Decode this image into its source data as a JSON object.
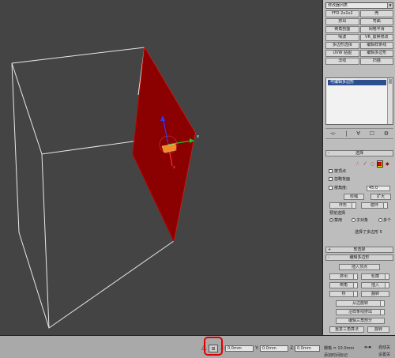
{
  "modifier_panel": {
    "dropdown_value": "修改器列表",
    "modifiers": [
      "FFD 2x2x2",
      "壳",
      "挤出",
      "弯曲",
      "倒角剖面",
      "网格平滑",
      "噪波",
      "VR_置换修改",
      "多边形选择",
      "编辑样条线",
      "UVW 贴图",
      "编辑多边形",
      "法线",
      "扫描"
    ],
    "stack_item": "可编辑多边形",
    "stack_tools": [
      "-ι-",
      "|",
      "∀",
      "☐",
      "⚙"
    ]
  },
  "selection": {
    "title": "选择",
    "by_vertex": "按顶点",
    "ignore_backfacing": "忽略背面",
    "by_angle": "按角度:",
    "angle_value": "45.0",
    "shrink": "收缩",
    "grow": "扩大",
    "ring": "环形",
    "loop": "循环",
    "preview_title": "预览选择",
    "preview_disable": "禁用",
    "preview_subobj": "子对象",
    "preview_multi": "多个",
    "status": "选择了多边形 5"
  },
  "soft_selection": {
    "title": "软选择"
  },
  "edit_polygons": {
    "title": "编辑多边形",
    "insert_vertex": "插入顶点",
    "extrude": "挤出",
    "outline": "轮廓",
    "bevel": "倒角",
    "inset": "插入",
    "bridge": "桥",
    "flip": "翻转",
    "hinge": "从边旋转",
    "extrude_spline": "沿样条线挤出",
    "edit_triangulation": "编辑三角剖分",
    "retriangulate": "重复三角算法",
    "turn": "旋转"
  },
  "status_bar": {
    "x_label": "X:",
    "x_value": "0.0mm",
    "y_label": "Y:",
    "y_value": "0.0mm",
    "z_label": "Z:",
    "z_value": "0.0mm",
    "grid": "栅格 = 10.0mm",
    "add_time_tag": "添加时间标记",
    "auto_key": "自动关",
    "set_key": "设置关"
  }
}
